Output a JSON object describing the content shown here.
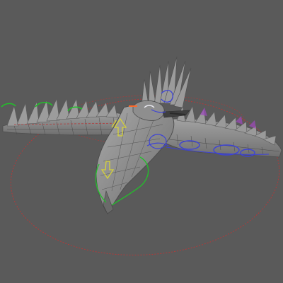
{
  "viewport": {
    "kind": "3d-modeling-viewport",
    "subject": "rigged-bird-wireframe",
    "background_color": "#5a5a5a",
    "mesh_color": "#8a8a8a",
    "mesh_highlight_color": "#b8b8b8",
    "mesh_shadow_color": "#4a4a4a",
    "controls": {
      "root_circle_color": "#b23a3a",
      "fk_control_color": "#3d43d6",
      "ik_control_color": "#22c02a",
      "arrow_control_color": "#d6d23a",
      "feather_tip_color": "#9a4bb8",
      "accent_color": "#ff6a2a",
      "white_control_color": "#e8e8ef"
    },
    "icons": [
      "root-control-circle",
      "wing-fk-controls",
      "wing-ik-controls",
      "body-arrow-controls",
      "tail-control-curve"
    ]
  }
}
